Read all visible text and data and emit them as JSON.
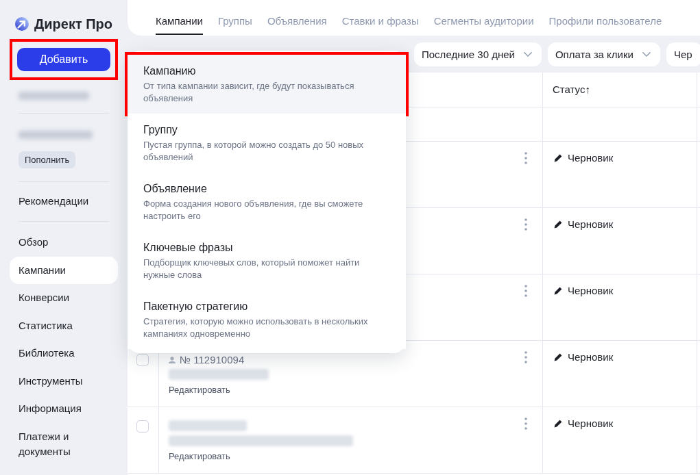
{
  "logo": {
    "text": "Директ Про"
  },
  "sidebar": {
    "add_button": {
      "label": "Добавить",
      "highlighted": true
    },
    "top_up_button": {
      "label": "Пополнить"
    },
    "recommendations": {
      "label": "Рекомендации"
    },
    "nav": [
      {
        "label": "Обзор",
        "selected": false
      },
      {
        "label": "Кампании",
        "selected": true
      },
      {
        "label": "Конверсии",
        "selected": false
      },
      {
        "label": "Статистика",
        "selected": false
      },
      {
        "label": "Библиотека",
        "selected": false
      },
      {
        "label": "Инструменты",
        "selected": false
      },
      {
        "label": "Информация",
        "selected": false
      },
      {
        "label": "Платежи и документы",
        "selected": false
      }
    ]
  },
  "tabs": [
    {
      "label": "Кампании",
      "selected": true
    },
    {
      "label": "Группы",
      "selected": false
    },
    {
      "label": "Объявления",
      "selected": false
    },
    {
      "label": "Ставки и фразы",
      "selected": false
    },
    {
      "label": "Сегменты аудитории",
      "selected": false
    },
    {
      "label": "Профили пользователе",
      "selected": false
    }
  ],
  "filters": [
    {
      "label": "Последние 30 дней",
      "caret": true
    },
    {
      "label": "Оплата за клики",
      "caret": true
    },
    {
      "label": "Чер",
      "caret": false
    }
  ],
  "add_menu": {
    "items": [
      {
        "title": "Кампанию",
        "description": "От типа кампании зависит, где будут показываться объявления",
        "highlighted": true
      },
      {
        "title": "Группу",
        "description": "Пустая группа, в которой можно создать до 50 новых объявлений",
        "highlighted": false
      },
      {
        "title": "Объявление",
        "description": "Форма создания нового объявления, где вы сможете настроить его",
        "highlighted": false
      },
      {
        "title": "Ключевые фразы",
        "description": "Подборщик ключевых слов, который поможет найти нужные слова",
        "highlighted": false
      },
      {
        "title": "Пакетную стратегию",
        "description": "Стратегия, которую можно использовать в нескольких кампаниях одновременно",
        "highlighted": false
      }
    ]
  },
  "table": {
    "status_column": {
      "label": "Статус↑"
    },
    "rows": [
      {
        "status": {
          "label": "Черновик",
          "kind": "draft"
        }
      },
      {
        "status": {
          "label": "Черновик",
          "kind": "draft"
        }
      },
      {
        "status": {
          "label": "Черновик",
          "kind": "draft"
        }
      },
      {
        "checked": false,
        "number": "№ 112910094",
        "edit_link": "Редактировать",
        "status": {
          "label": "Черновик",
          "kind": "draft"
        }
      },
      {
        "checked": false,
        "edit_link": "Редактировать",
        "status": {
          "label": "Черновик",
          "kind": "draft"
        }
      }
    ]
  }
}
